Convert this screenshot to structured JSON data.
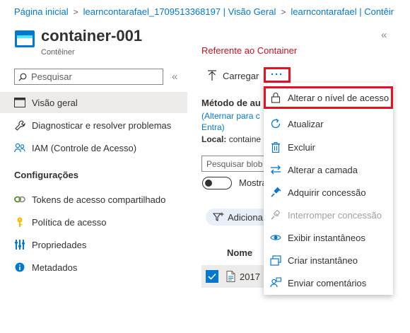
{
  "breadcrumb": {
    "items": [
      "Página inicial",
      "learncontarafael_1709513368197 | Visão Geral",
      "learncontarafael | Contêir"
    ],
    "separator": ">"
  },
  "header": {
    "title": "container-001",
    "subtitle": "Contêiner",
    "collapse_glyph": "«"
  },
  "sidebar": {
    "search_placeholder": "Pesquisar",
    "collapse_glyph": "«",
    "items": [
      {
        "label": "Visão geral",
        "icon": "overview-icon",
        "active": true
      },
      {
        "label": "Diagnosticar e resolver problemas",
        "icon": "wrench-icon"
      },
      {
        "label": "IAM (Controle de Acesso)",
        "icon": "people-icon"
      }
    ],
    "section_title": "Configurações",
    "settings_items": [
      {
        "label": "Tokens de acesso compartilhado",
        "icon": "link-icon"
      },
      {
        "label": "Política de acesso",
        "icon": "key-icon"
      },
      {
        "label": "Propriedades",
        "icon": "properties-icon"
      },
      {
        "label": "Metadados",
        "icon": "info-icon"
      }
    ]
  },
  "main": {
    "section_header": "Referente ao Container",
    "upload_label": "Carregar",
    "more_label": "···",
    "auth_label": "Método de au",
    "auth_link": "(Alternar para c Entra)",
    "local_label": "Local:",
    "local_value": "containe",
    "blob_search_placeholder": "Pesquisar blob",
    "toggle_label": "Mostra",
    "add_filter_label": "Adiciona",
    "column_name": "Nome",
    "file_name": "2017"
  },
  "menu": {
    "items": [
      {
        "label": "Alterar o nível de acesso",
        "icon": "lock-icon",
        "highlighted": true,
        "disabled": false
      },
      {
        "label": "Atualizar",
        "icon": "refresh-icon",
        "disabled": false
      },
      {
        "label": "Excluir",
        "icon": "trash-icon",
        "disabled": false
      },
      {
        "label": "Alterar a camada",
        "icon": "swap-icon",
        "disabled": false
      },
      {
        "label": "Adquirir concessão",
        "icon": "acquire-lease-icon",
        "disabled": false
      },
      {
        "label": "Interromper concessão",
        "icon": "break-lease-icon",
        "disabled": true
      },
      {
        "label": "Exibir instantâneos",
        "icon": "eye-icon",
        "disabled": false
      },
      {
        "label": "Criar instantâneo",
        "icon": "snapshot-icon",
        "disabled": false
      },
      {
        "label": "Enviar comentários",
        "icon": "feedback-icon",
        "disabled": false
      }
    ]
  },
  "colors": {
    "accent": "#0078d4",
    "highlight_border": "#e81123",
    "section_red": "#c50f1f",
    "active_bg": "#edebe9",
    "disabled_text": "#a19f9d"
  }
}
